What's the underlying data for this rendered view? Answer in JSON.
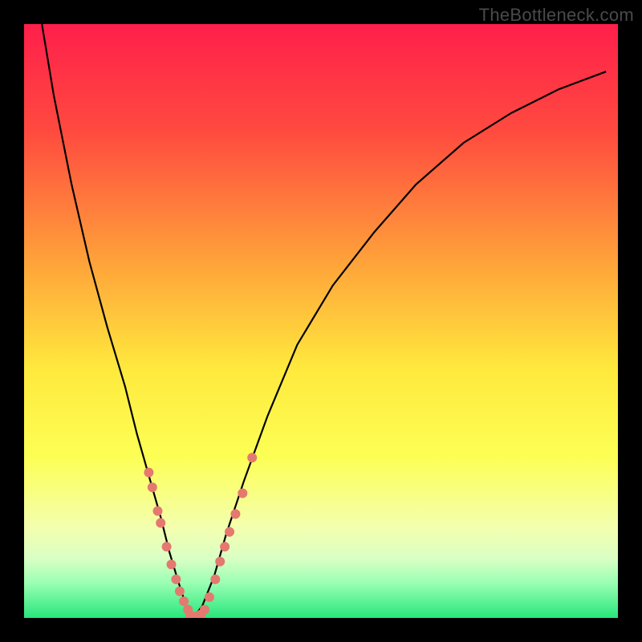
{
  "watermark": "TheBottleneck.com",
  "chart_data": {
    "type": "line",
    "title": "",
    "xlabel": "",
    "ylabel": "",
    "xlim": [
      0,
      100
    ],
    "ylim": [
      0,
      100
    ],
    "gradient_stops": [
      {
        "offset": 0,
        "color": "#ff1f4b"
      },
      {
        "offset": 18,
        "color": "#ff4a3f"
      },
      {
        "offset": 40,
        "color": "#ffa23a"
      },
      {
        "offset": 58,
        "color": "#ffe93d"
      },
      {
        "offset": 73,
        "color": "#fdff55"
      },
      {
        "offset": 85,
        "color": "#f3ffb0"
      },
      {
        "offset": 90,
        "color": "#d9ffc4"
      },
      {
        "offset": 94,
        "color": "#9cffb4"
      },
      {
        "offset": 100,
        "color": "#27e67c"
      }
    ],
    "series": [
      {
        "name": "bottleneck-curve",
        "type": "line",
        "x": [
          3,
          5,
          8,
          11,
          14,
          17,
          19,
          21,
          23,
          24.5,
          26,
          27.3,
          28.5,
          30,
          32,
          34,
          37,
          41,
          46,
          52,
          59,
          66,
          74,
          82,
          90,
          98
        ],
        "y": [
          100,
          88,
          73,
          60,
          49,
          39,
          31,
          24,
          17,
          11,
          6,
          2,
          0,
          2,
          7,
          14,
          23,
          34,
          46,
          56,
          65,
          73,
          80,
          85,
          89,
          92
        ]
      },
      {
        "name": "highlight-dots-left",
        "type": "scatter",
        "x": [
          21.0,
          21.6,
          22.5,
          23.0,
          24.0,
          24.8,
          25.6,
          26.2,
          26.9,
          27.6
        ],
        "y": [
          24.5,
          22.0,
          18.0,
          16.0,
          12.0,
          9.0,
          6.5,
          4.5,
          2.8,
          1.4
        ]
      },
      {
        "name": "highlight-dots-bottom",
        "type": "scatter",
        "x": [
          28.0,
          28.6,
          29.2,
          29.8,
          30.4
        ],
        "y": [
          0.4,
          0.2,
          0.3,
          0.6,
          1.4
        ]
      },
      {
        "name": "highlight-dots-right",
        "type": "scatter",
        "x": [
          31.2,
          32.2,
          33.0,
          33.8,
          34.6,
          35.6,
          36.8,
          38.4
        ],
        "y": [
          3.5,
          6.5,
          9.5,
          12.0,
          14.5,
          17.5,
          21.0,
          27.0
        ]
      }
    ],
    "dot_radius_px": 6
  }
}
